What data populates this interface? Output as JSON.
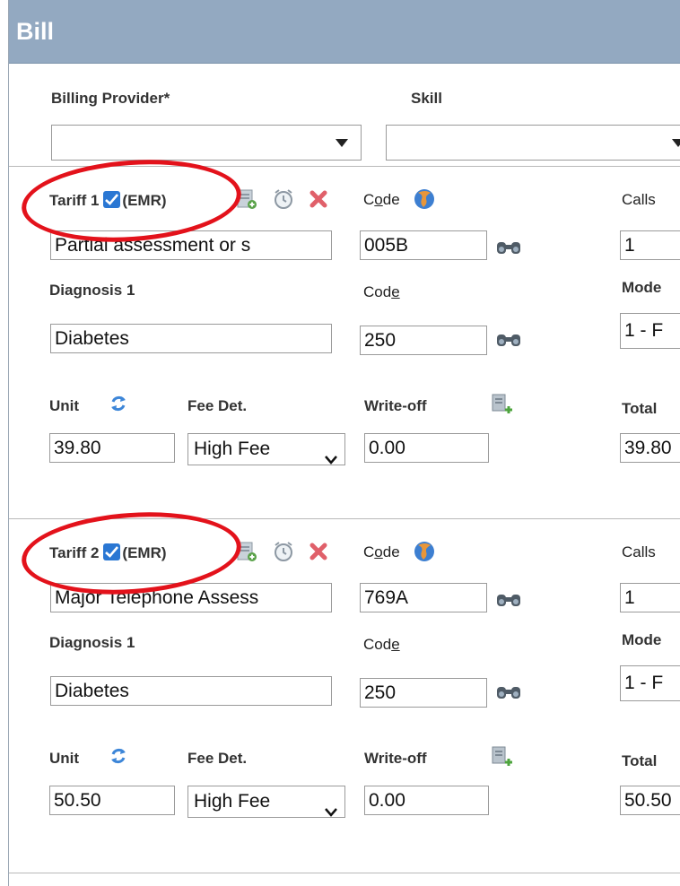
{
  "window": {
    "title": "Bill"
  },
  "header": {
    "billing_provider_label": "Billing Provider*",
    "billing_provider_value": "",
    "skill_label": "Skill",
    "skill_value": ""
  },
  "tariffs": [
    {
      "tariff_label": "Tariff 1",
      "emr_label": "(EMR)",
      "emr_checked": true,
      "code_label_prefix": "C",
      "code_label_underline": "o",
      "code_label_suffix": "de",
      "description_value": "Partial assessment or s",
      "code_value": "005B",
      "calls_label": "Calls",
      "calls_value": "1",
      "diagnosis_label": "Diagnosis 1",
      "diag_code_label_prefix": "Cod",
      "diag_code_label_underline": "e",
      "diagnosis_value": "Diabetes",
      "diag_code_value": "250",
      "mode_label": "Mode",
      "mode_value": "1 - F",
      "unit_label": "Unit",
      "fee_det_label": "Fee Det.",
      "write_off_label": "Write-off",
      "total_label": "Total",
      "unit_value": "39.80",
      "fee_det_value": "High Fee",
      "write_off_value": "0.00",
      "total_value": "39.80"
    },
    {
      "tariff_label": "Tariff 2",
      "emr_label": "(EMR)",
      "emr_checked": true,
      "code_label_prefix": "C",
      "code_label_underline": "o",
      "code_label_suffix": "de",
      "description_value": "Major Telephone Assess",
      "code_value": "769A",
      "calls_label": "Calls",
      "calls_value": "1",
      "diagnosis_label": "Diagnosis 1",
      "diag_code_label_prefix": "Cod",
      "diag_code_label_underline": "e",
      "diagnosis_value": "Diabetes",
      "diag_code_value": "250",
      "mode_label": "Mode",
      "mode_value": "1 - F",
      "unit_label": "Unit",
      "fee_det_label": "Fee Det.",
      "write_off_label": "Write-off",
      "total_label": "Total",
      "unit_value": "50.50",
      "fee_det_value": "High Fee",
      "write_off_value": "0.00",
      "total_value": "50.50"
    }
  ],
  "icons": {
    "save_item": "save-item-icon",
    "alarm": "alarm-clock-icon",
    "delete": "delete-x-icon",
    "globe": "globe-icon",
    "search": "binoculars-icon",
    "refresh": "refresh-icon",
    "add_write_off": "add-document-icon"
  },
  "colors": {
    "title_bar": "#93a9c1",
    "highlight_ellipse": "#e3121b",
    "checkbox": "#2a77d3",
    "delete": "#e0606a"
  }
}
